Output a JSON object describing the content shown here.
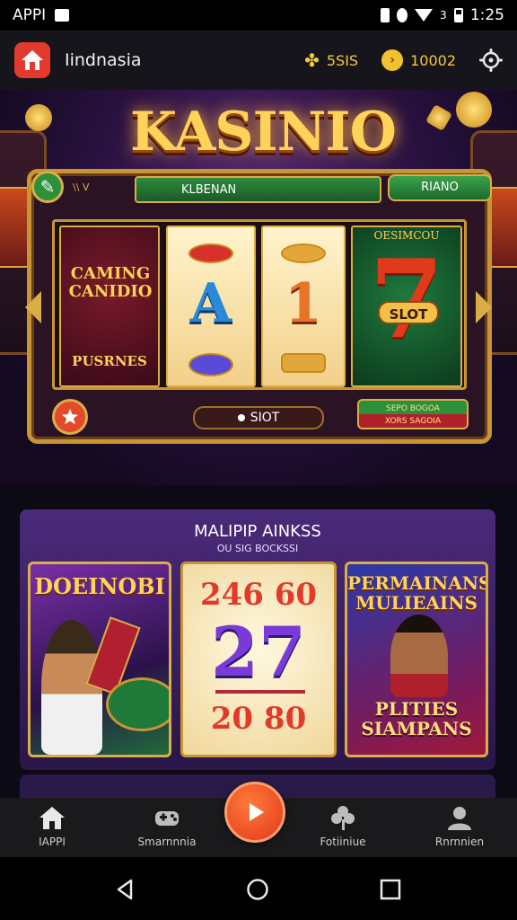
{
  "status_bar": {
    "left_text": "APPI",
    "time": "1:25",
    "signal_digit": "3"
  },
  "header": {
    "app_name": "Iindnasia",
    "coins_value": "5SIS",
    "gems_value": "10002"
  },
  "hero": {
    "title": "KASINIO",
    "subtitle": "KLBENAN",
    "small_tag": "\\\\ V",
    "top_button": "RIANO",
    "reel1_title": "CAMING CANIDIO",
    "reel1_footer": "PUSRNES",
    "reel2_symbol": "A",
    "reel3_symbol": "1",
    "reel4_top": "OESIMCOU",
    "reel4_label": "SLOT",
    "slot_pill": "SIOT",
    "promo_line1": "SEPO BOGOA",
    "promo_line2": "XORS SAGOIA"
  },
  "games": {
    "title": "MALIPIP AINKSS",
    "subtitle": "OU SIG BOCKSSI",
    "cards": [
      {
        "title": "DOEINOBI"
      },
      {
        "line1": "246 60",
        "big": "27",
        "line3": "20 80"
      },
      {
        "title": "PERMAINANS MULIEAINS",
        "footer": "PLITIES SIAMPANS"
      }
    ]
  },
  "bottom_nav": {
    "items": [
      {
        "label": "IAPPI",
        "icon": "home-icon"
      },
      {
        "label": "Smarnnnia",
        "icon": "gamepad-icon"
      },
      {
        "label": "Fotiiniue",
        "icon": "clover-icon"
      },
      {
        "label": "Rnrnnien",
        "icon": "user-icon"
      }
    ],
    "center_icon": "play-icon"
  },
  "colors": {
    "accent": "#e2381a",
    "gold": "#d9ad48",
    "currency": "#f3c83a"
  }
}
